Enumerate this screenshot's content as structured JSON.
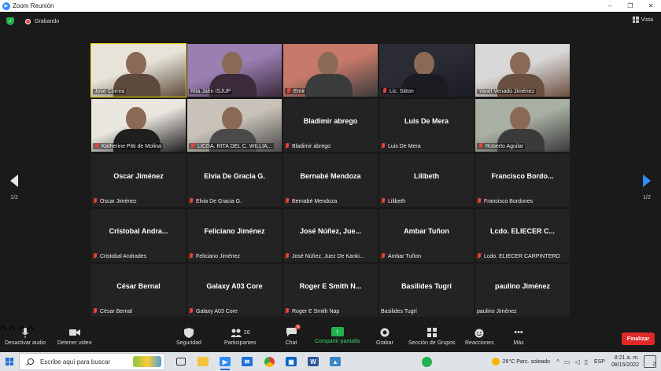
{
  "window": {
    "title": "Zoom Reunión"
  },
  "top": {
    "recording_label": "Grabando",
    "view_label": "Vista"
  },
  "pager": {
    "left": "1/2",
    "right": "1/2"
  },
  "participants": [
    {
      "tile": "Jose Correa",
      "label": "Jose Correa",
      "video": true,
      "active": true,
      "muted": false
    },
    {
      "tile": "Rita Jaén ISJUP",
      "label": "Rita Jaén ISJUP",
      "video": true,
      "muted": false
    },
    {
      "tile": "Emir",
      "label": "Emir",
      "video": true,
      "muted": true
    },
    {
      "tile": "Lic. Sitton",
      "label": "Lic. Sitton",
      "video": true,
      "muted": true
    },
    {
      "tile": "Yanel Venado Jiménez",
      "label": "Yanel Venado Jiménez",
      "video": true,
      "muted": false
    },
    {
      "tile": "Katherine Pitti de Molina",
      "label": "Katherine Pitti de Molina",
      "video": true,
      "muted": true
    },
    {
      "tile": "LICDA. RITA DEL C. WILLIA...",
      "label": "LICDA. RITA DEL C. WILLIA...",
      "video": true,
      "muted": true
    },
    {
      "tile": "Bladimir abrego",
      "label": "Bladimir abrego",
      "video": false,
      "muted": true
    },
    {
      "tile": "Luis De Mera",
      "label": "Luis De Mera",
      "video": false,
      "muted": true
    },
    {
      "tile": "Roberto Aguilar",
      "label": "Roberto Aguilar",
      "video": true,
      "muted": true
    },
    {
      "tile": "Oscar Jiménez",
      "label": "Oscar Jiménez",
      "video": false,
      "muted": true
    },
    {
      "tile": "Elvia De Gracia G.",
      "label": "Elvia De Gracia G.",
      "video": false,
      "muted": true
    },
    {
      "tile": "Bernabé Mendoza",
      "label": "Bernabé Mendoza",
      "video": false,
      "muted": true
    },
    {
      "tile": "Lilibeth",
      "label": "Lilibeth",
      "video": false,
      "muted": true
    },
    {
      "tile": "Francisco  Bordo...",
      "label": "Francisco Bordones",
      "video": false,
      "muted": true
    },
    {
      "tile": "Cristobal  Andra...",
      "label": "Cristobal Andrades",
      "video": false,
      "muted": true
    },
    {
      "tile": "Feliciano Jiménez",
      "label": "Feliciano Jiménez",
      "video": false,
      "muted": true
    },
    {
      "tile": "José Núñez, Jue...",
      "label": "José Núñez, Juez De Kanki...",
      "video": false,
      "muted": true
    },
    {
      "tile": "Ambar Tuñon",
      "label": "Ambar Tuñon",
      "video": false,
      "muted": true
    },
    {
      "tile": "Lcdo. ELIECER C...",
      "label": "Lcdo. ELIECER CARPINTERO",
      "video": false,
      "muted": true
    },
    {
      "tile": "César Bernal",
      "label": "César Bernal",
      "video": false,
      "muted": true
    },
    {
      "tile": "Galaxy A03 Core",
      "label": "Galaxy A03 Core",
      "video": false,
      "muted": true
    },
    {
      "tile": "Roger E Smith N...",
      "label": "Roger E Smith Nap",
      "video": false,
      "muted": true
    },
    {
      "tile": "Basilides Tugrí",
      "label": "Basilides Tugrí",
      "video": false,
      "muted": false
    },
    {
      "tile": "paulino Jiménez",
      "label": "paulino Jiménez",
      "video": false,
      "muted": false
    }
  ],
  "toolbar": {
    "mute": "Desactivar audio",
    "video": "Detener video",
    "security": "Seguridad",
    "participants": "Participantes",
    "participants_count": "26",
    "chat": "Chat",
    "chat_badge": "6",
    "share": "Compartir pantalla",
    "record": "Grabar",
    "breakout": "Sección de Grupos",
    "reactions": "Reacciones",
    "more": "Más",
    "end": "Finalizar"
  },
  "taskbar": {
    "search_placeholder": "Escribe aquí para buscar",
    "weather": "26°C  Parc. soleado",
    "lang": "ESP",
    "time": "8:21 a. m.",
    "date": "08/15/2022",
    "notif_count": "2"
  },
  "colors": {
    "accent": "#2d8cff",
    "active_speaker": "#f5e60a",
    "end": "#e02828",
    "share": "#22b14c"
  }
}
